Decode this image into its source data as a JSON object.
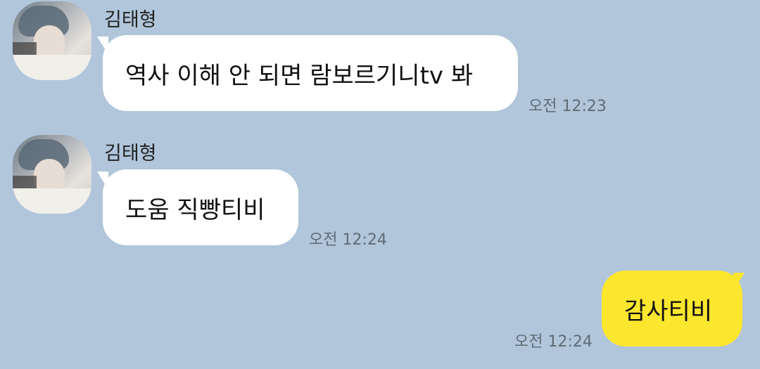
{
  "messages": [
    {
      "sender": "김태형",
      "text": "역사 이해 안 되면 람보르기니tv 봐",
      "time": "오전 12:23",
      "direction": "incoming"
    },
    {
      "sender": "김태형",
      "text": "도움 직빵티비",
      "time": "오전 12:24",
      "direction": "incoming"
    },
    {
      "text": "감사티비",
      "time": "오전 12:24",
      "direction": "outgoing"
    }
  ],
  "colors": {
    "background": "#b1c6db",
    "incoming_bubble": "#ffffff",
    "outgoing_bubble": "#fde62e"
  }
}
